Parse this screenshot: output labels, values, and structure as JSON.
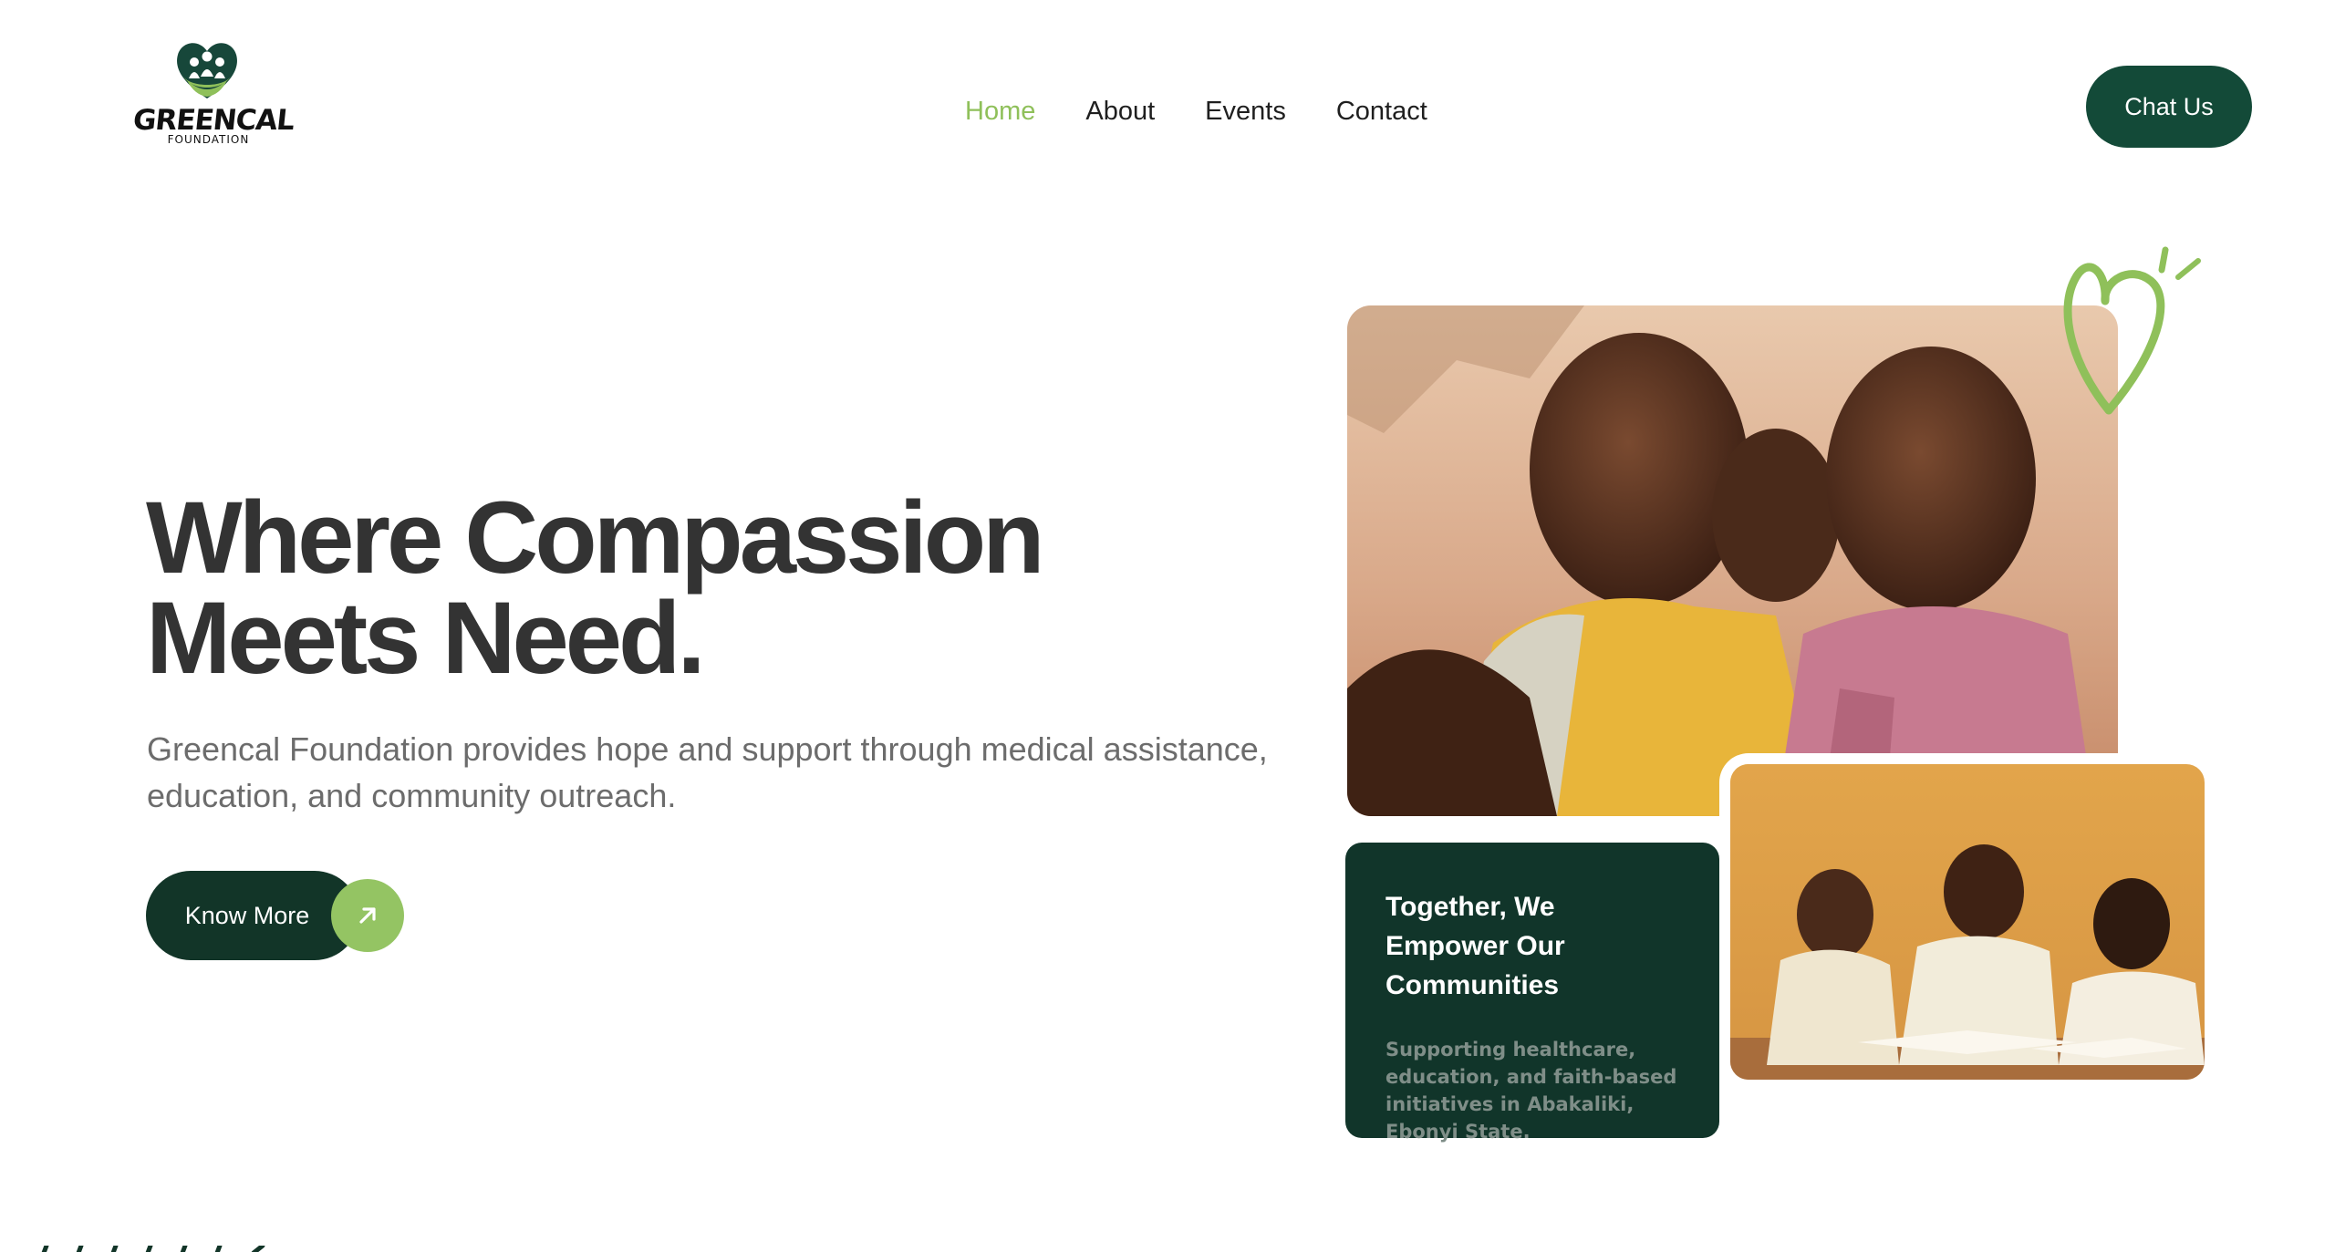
{
  "brand": {
    "name": "GREENCAL",
    "sub": "FOUNDATION",
    "colors": {
      "dark_green": "#134a38",
      "card_green": "#11352a",
      "lime": "#8fc05a"
    }
  },
  "nav": {
    "items": [
      {
        "label": "Home",
        "active": true
      },
      {
        "label": "About",
        "active": false
      },
      {
        "label": "Events",
        "active": false
      },
      {
        "label": "Contact",
        "active": false
      }
    ],
    "cta": "Chat Us"
  },
  "hero": {
    "title_line1": "Where Compassion",
    "title_line2": "Meets Need.",
    "subtitle": "Greencal Foundation provides hope and support through medical assistance, education, and community outreach.",
    "button_label": "Know More",
    "button_icon": "arrow-up-right-icon"
  },
  "card": {
    "title": "Together, We Empower Our Communities",
    "text": "Supporting healthcare, education, and faith-based initiatives in Abakaliki, Ebonyi State."
  }
}
